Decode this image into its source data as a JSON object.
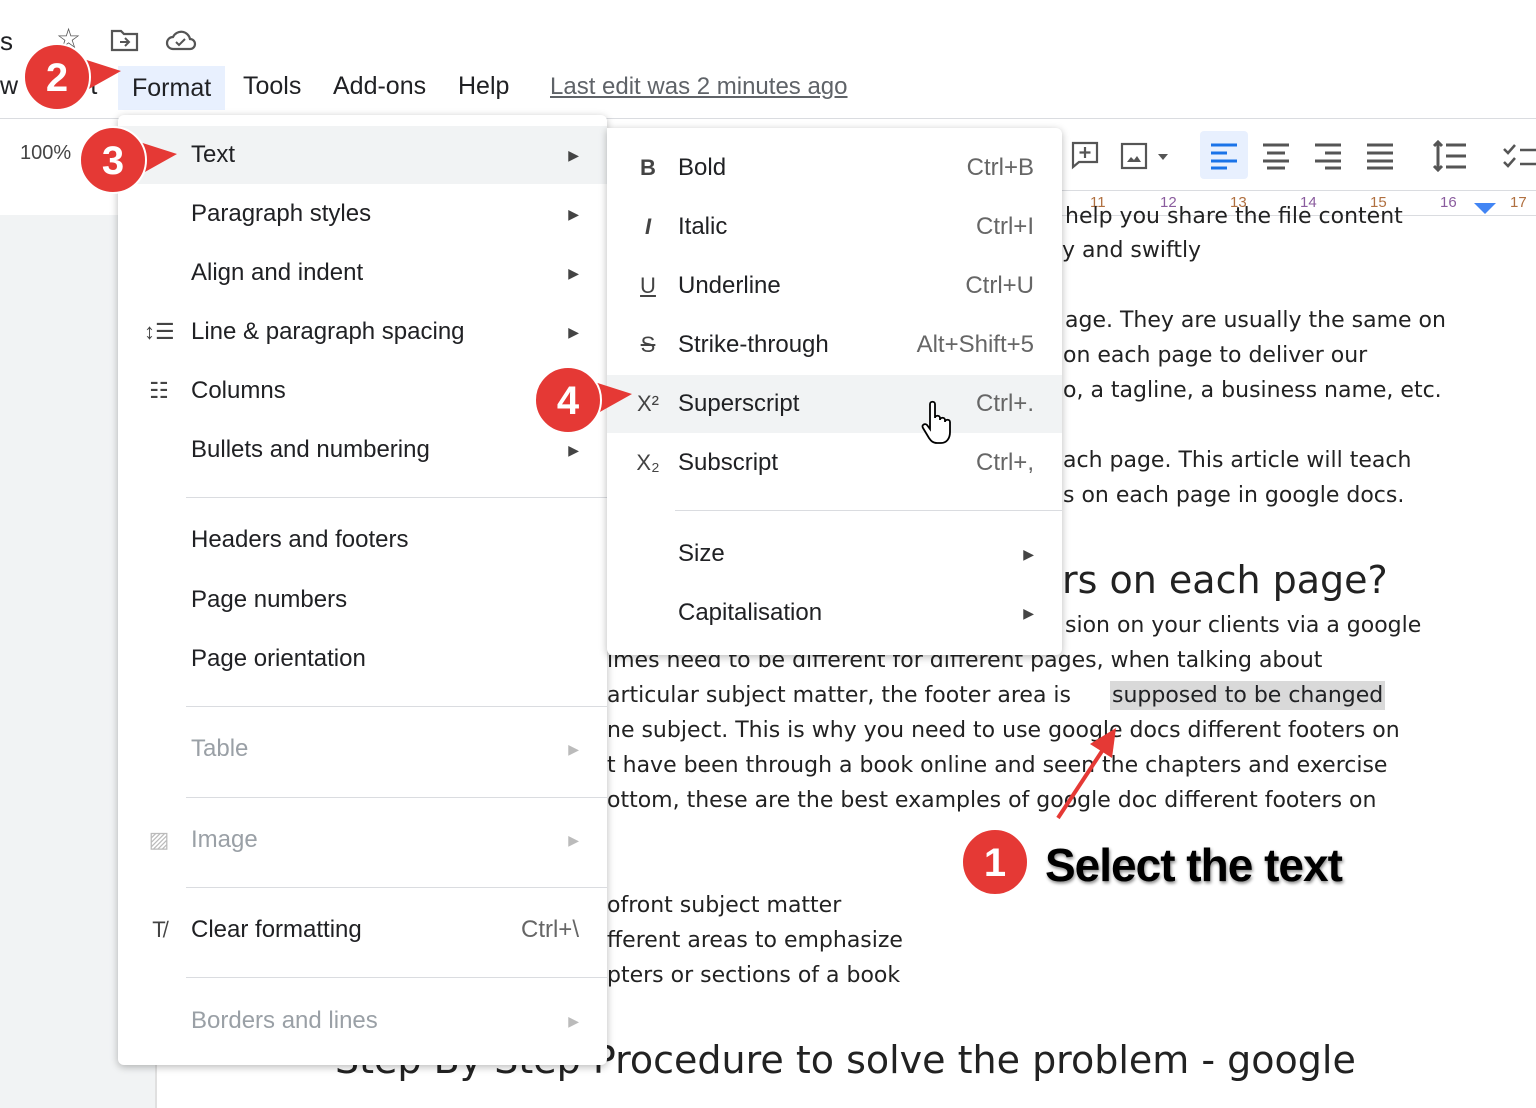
{
  "titlebar": {
    "title_fragment": "s",
    "icons": [
      "star-icon",
      "move-to-folder-icon",
      "cloud-saved-icon"
    ]
  },
  "menubar": {
    "partial_left": "w",
    "partial_insert": "rt",
    "items": [
      "Format",
      "Tools",
      "Add-ons",
      "Help"
    ],
    "last_edit": "Last edit was 2 minutes ago"
  },
  "toolbar": {
    "zoom": "100%",
    "icons": [
      "add-comment-icon",
      "insert-image-icon",
      "align-left-icon",
      "align-center-icon",
      "align-right-icon",
      "justify-icon",
      "line-spacing-icon",
      "checklist-icon"
    ],
    "accent": "#1a73e8"
  },
  "ruler": {
    "ticks": [
      "11",
      "12",
      "13",
      "14",
      "15",
      "16",
      "17"
    ]
  },
  "format_menu": {
    "items": [
      {
        "label": "Text",
        "arrow": true,
        "hover": true
      },
      {
        "label": "Paragraph styles",
        "arrow": true
      },
      {
        "label": "Align and indent",
        "arrow": true
      },
      {
        "label": "Line & paragraph spacing",
        "arrow": true,
        "icon": "line-spacing-icon"
      },
      {
        "label": "Columns",
        "arrow": true,
        "icon": "columns-icon"
      },
      {
        "label": "Bullets and numbering",
        "arrow": true
      },
      {
        "label": "Headers and footers"
      },
      {
        "label": "Page numbers"
      },
      {
        "label": "Page orientation"
      },
      {
        "label": "Table",
        "arrow": true,
        "disabled": true
      },
      {
        "label": "Image",
        "arrow": true,
        "disabled": true,
        "icon": "image-icon"
      },
      {
        "label": "Clear formatting",
        "shortcut": "Ctrl+\\",
        "icon": "clear-formatting-icon"
      },
      {
        "label": "Borders and lines",
        "arrow": true,
        "disabled": true
      }
    ]
  },
  "text_submenu": {
    "items": [
      {
        "label": "Bold",
        "shortcut": "Ctrl+B",
        "icon": "bold-icon"
      },
      {
        "label": "Italic",
        "shortcut": "Ctrl+I",
        "icon": "italic-icon"
      },
      {
        "label": "Underline",
        "shortcut": "Ctrl+U",
        "icon": "underline-icon"
      },
      {
        "label": "Strike-through",
        "shortcut": "Alt+Shift+5",
        "icon": "strikethrough-icon"
      },
      {
        "label": "Superscript",
        "shortcut": "Ctrl+.",
        "icon": "superscript-icon",
        "hover": true
      },
      {
        "label": "Subscript",
        "shortcut": "Ctrl+,",
        "icon": "subscript-icon"
      },
      {
        "label": "Size",
        "arrow": true
      },
      {
        "label": "Capitalisation",
        "arrow": true
      }
    ]
  },
  "document": {
    "lines": [
      "help you share the file content",
      "y and swiftly",
      "age. They are usually the same on",
      "on each page to deliver our",
      "o, a tagline, a business name, etc.",
      "ach page. This article will teach",
      "s on each page in google docs.",
      "sion on your clients via a google",
      "imes need to be different for different pages, when talking about",
      "articular subject matter, the footer area is ",
      "ne subject. This is why you need to use google docs different footers on",
      "t have been through a book online and seen the chapters and exercise",
      "ottom, these are the best examples of google doc different footers on",
      "ofront subject matter",
      "fferent areas to emphasize",
      "pters or sections of a book"
    ],
    "selected_text": "supposed to be changed",
    "heading1": "rs on each page?",
    "heading2": "Step By Step Procedure to solve the problem - google"
  },
  "annotations": {
    "badges": [
      "1",
      "2",
      "3",
      "4"
    ],
    "callout": "Select the text",
    "color": "#e53935"
  }
}
